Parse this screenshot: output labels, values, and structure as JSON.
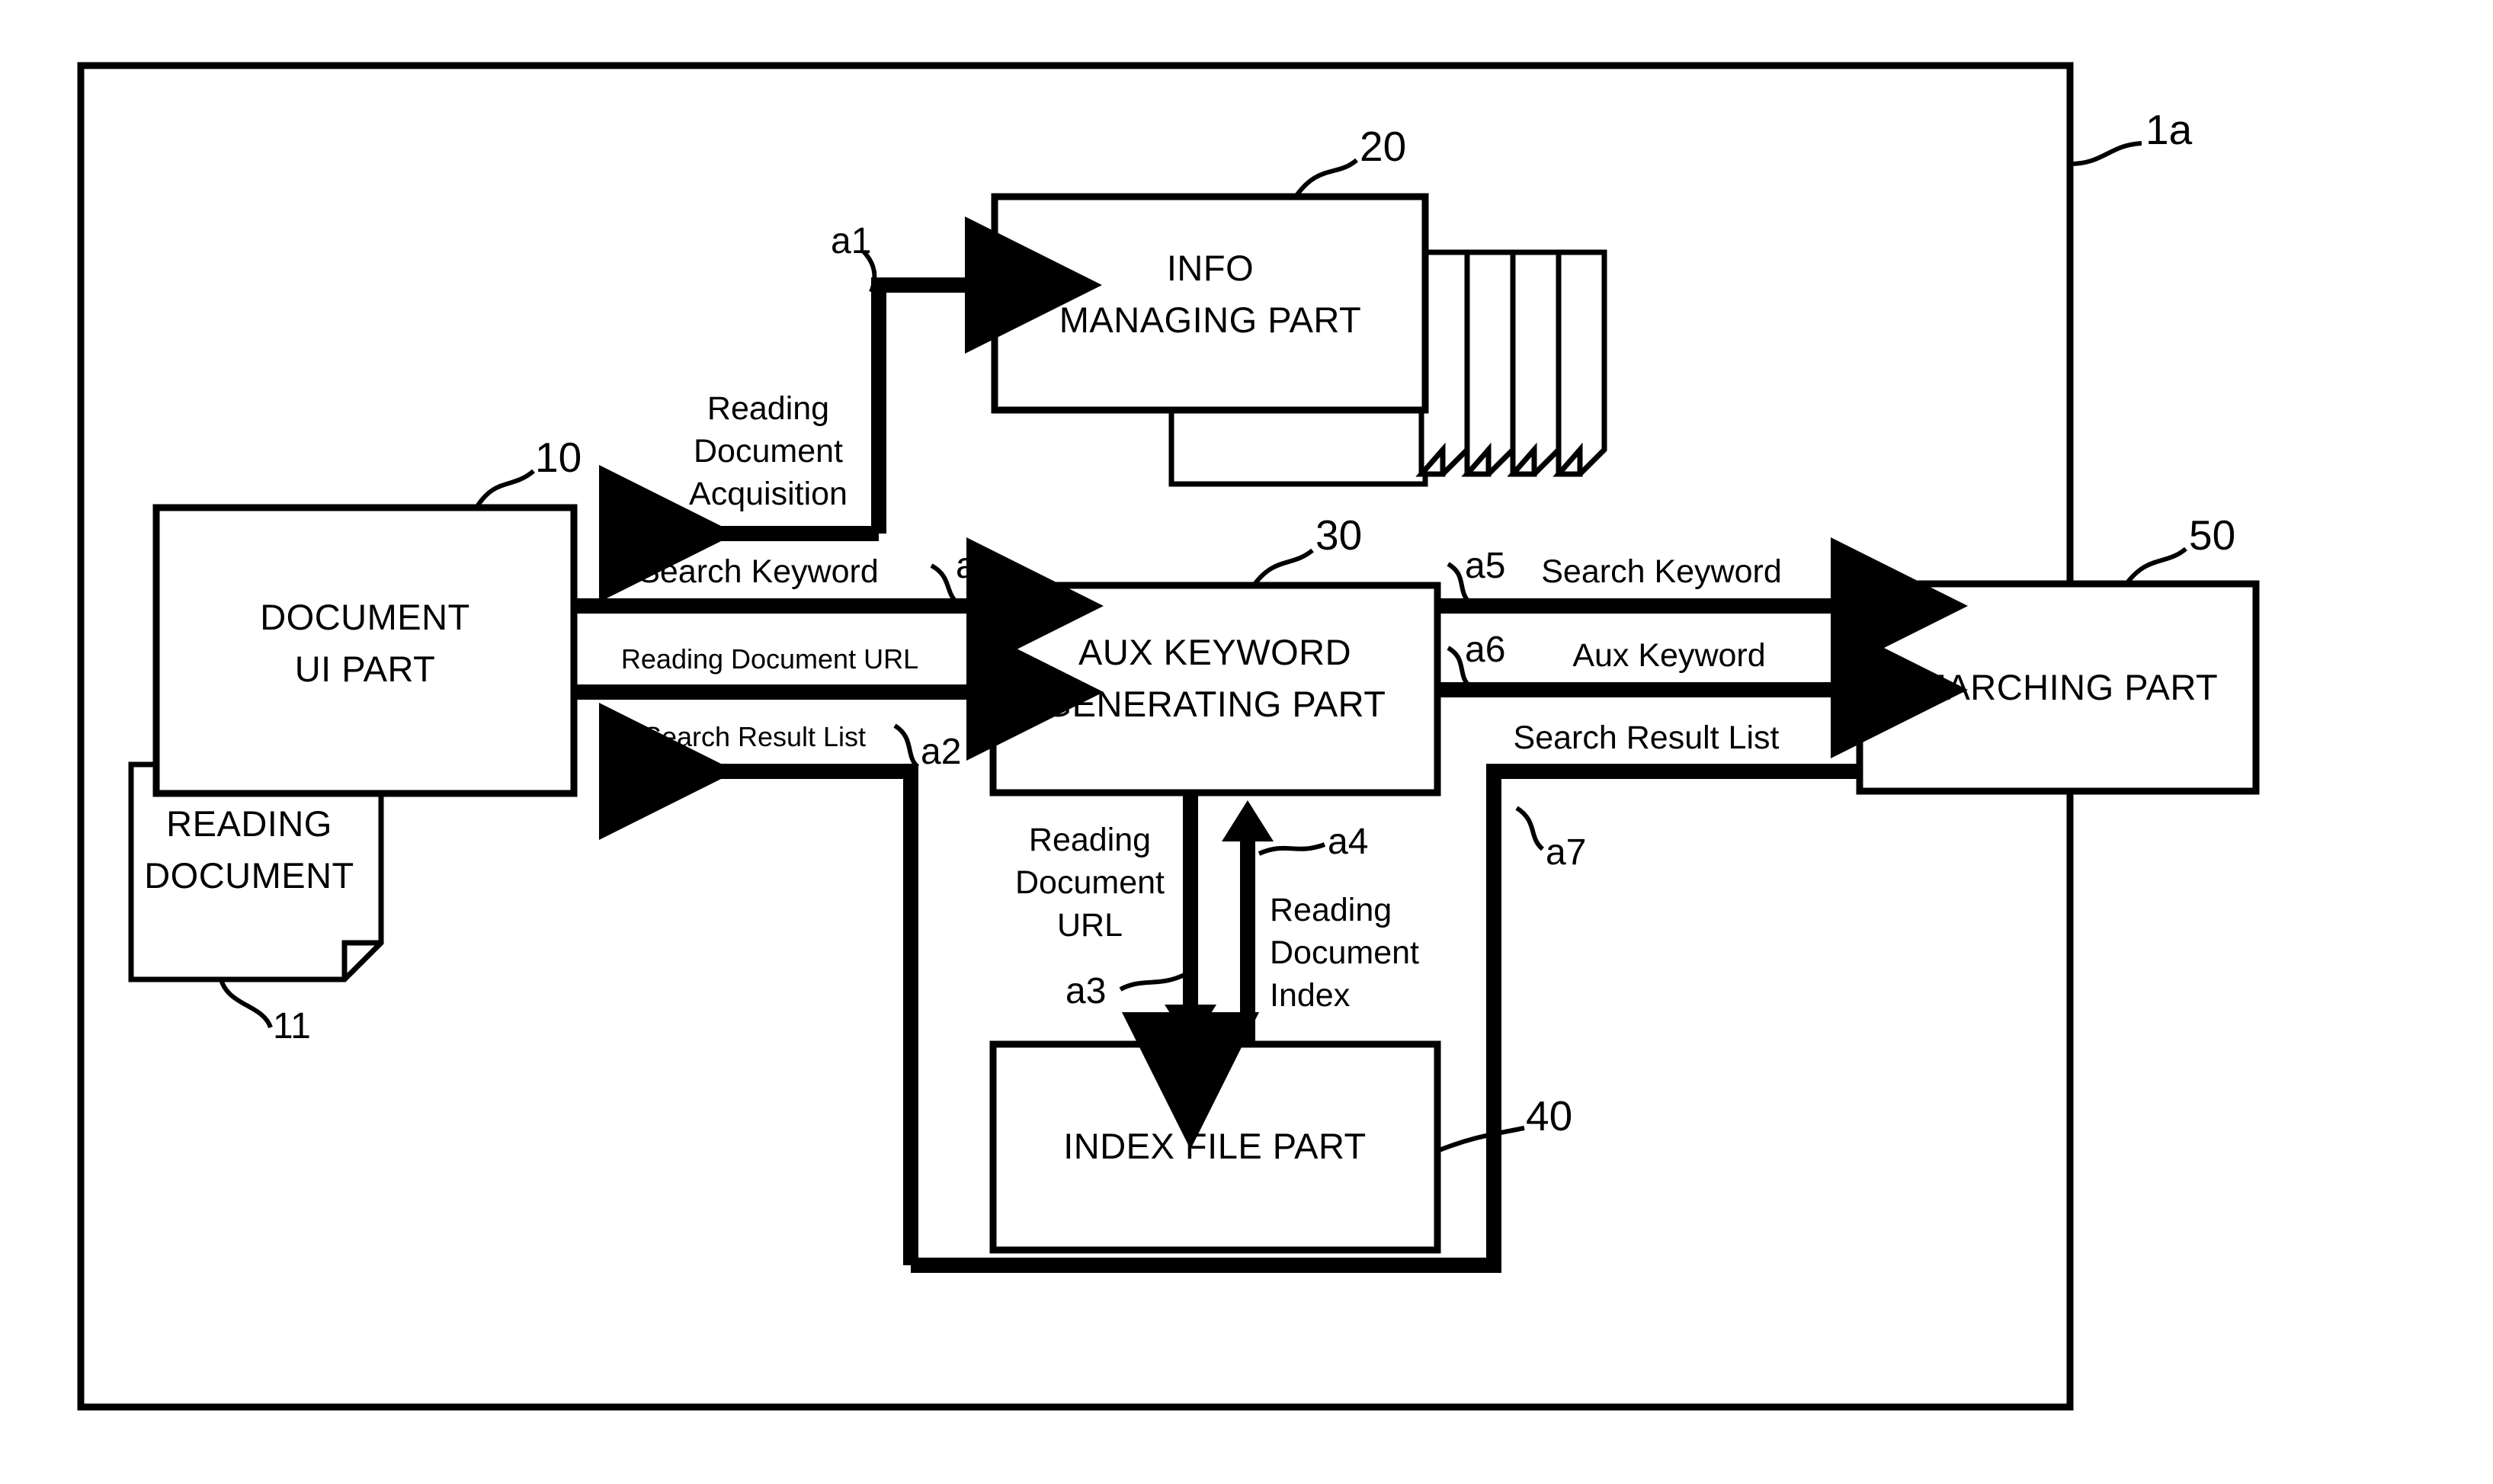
{
  "figure": {
    "type": "block-diagram",
    "outer_frame_ref": "1a",
    "background": "#ffffff",
    "line_color": "#000000"
  },
  "blocks": [
    {
      "id": "document_ui_part",
      "title_line1": "DOCUMENT",
      "title_line2": "UI PART",
      "ref": "10"
    },
    {
      "id": "reading_document",
      "title_line1": "READING",
      "title_line2": "DOCUMENT",
      "ref": "11"
    },
    {
      "id": "info_managing_part",
      "title_line1": "INFO",
      "title_line2": "MANAGING PART",
      "ref": "20"
    },
    {
      "id": "aux_keyword_generating_part",
      "title_line1": "AUX KEYWORD",
      "title_line2": "GENERATING PART",
      "ref": "30"
    },
    {
      "id": "index_file_part",
      "title_line1": "INDEX FILE PART",
      "title_line2": "",
      "ref": "40"
    },
    {
      "id": "searching_part",
      "title_line1": "SEARCHING PART",
      "title_line2": "",
      "ref": "50"
    }
  ],
  "flows": [
    {
      "id": "a1",
      "tag": "a1",
      "label": "Reading\nDocument\nAcquisition",
      "label_line1": "Reading",
      "label_line2": "Document",
      "label_line3": "Acquisition",
      "from": "document_ui_part",
      "to": "info_managing_part"
    },
    {
      "id": "a5_left",
      "tag": "a5",
      "label": "Search Keyword",
      "from": "document_ui_part",
      "to": "aux_keyword_generating_part"
    },
    {
      "id": "url_left",
      "tag": "",
      "label": "Reading Document URL",
      "from": "document_ui_part",
      "to": "aux_keyword_generating_part"
    },
    {
      "id": "a2",
      "tag": "a2",
      "label": "Search Result List",
      "from": "aux_keyword_generating_part",
      "to": "document_ui_part"
    },
    {
      "id": "a3",
      "tag": "a3",
      "label": "Reading\nDocument\nURL",
      "label_line1": "Reading",
      "label_line2": "Document",
      "label_line3": "URL",
      "from": "aux_keyword_generating_part",
      "to": "index_file_part"
    },
    {
      "id": "a4",
      "tag": "a4",
      "label": "Reading\nDocument\nIndex",
      "label_line1": "Reading",
      "label_line2": "Document",
      "label_line3": "Index",
      "from": "index_file_part",
      "to": "aux_keyword_generating_part"
    },
    {
      "id": "a5_right",
      "tag": "a5",
      "label": "Search Keyword",
      "from": "aux_keyword_generating_part",
      "to": "searching_part"
    },
    {
      "id": "a6",
      "tag": "a6",
      "label": "Aux Keyword",
      "from": "aux_keyword_generating_part",
      "to": "searching_part"
    },
    {
      "id": "a7",
      "tag": "a7",
      "label": "Search Result List",
      "from": "searching_part",
      "to": "aux_keyword_generating_part"
    }
  ],
  "labels": {
    "frame_ref": "1a",
    "ref_10": "10",
    "ref_11": "11",
    "ref_20": "20",
    "ref_30": "30",
    "ref_40": "40",
    "ref_50": "50",
    "a1": "a1",
    "a2": "a2",
    "a3": "a3",
    "a4": "a4",
    "a5_left": "a5",
    "a5_right": "a5",
    "a6": "a6",
    "a7": "a7",
    "reading_doc_acq_l1": "Reading",
    "reading_doc_acq_l2": "Document",
    "reading_doc_acq_l3": "Acquisition",
    "search_keyword_left": "Search Keyword",
    "reading_document_url_left": "Reading Document URL",
    "search_result_list_left": "Search Result List",
    "reading_doc_url_l1": "Reading",
    "reading_doc_url_l2": "Document",
    "reading_doc_url_l3": "URL",
    "reading_doc_index_l1": "Reading",
    "reading_doc_index_l2": "Document",
    "reading_doc_index_l3": "Index",
    "search_keyword_right": "Search Keyword",
    "aux_keyword_right": "Aux Keyword",
    "search_result_list_right": "Search Result List",
    "document_ui_part_l1": "DOCUMENT",
    "document_ui_part_l2": "UI PART",
    "reading_document_l1": "READING",
    "reading_document_l2": "DOCUMENT",
    "info_managing_part_l1": "INFO",
    "info_managing_part_l2": "MANAGING PART",
    "aux_keyword_l1": "AUX KEYWORD",
    "aux_keyword_l2": "GENERATING PART",
    "index_file_part": "INDEX FILE PART",
    "searching_part": "SEARCHING PART"
  }
}
